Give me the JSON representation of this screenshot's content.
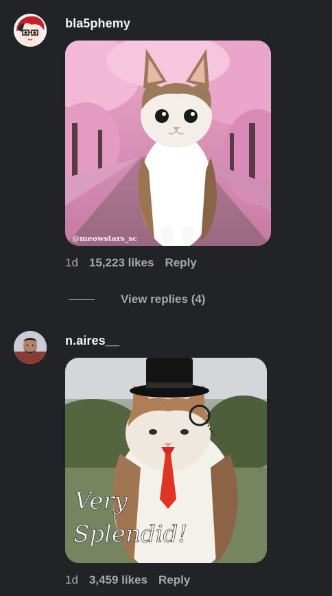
{
  "comments": [
    {
      "username": "bla5phemy",
      "media_watermark": "@meowstars_sc",
      "age": "1d",
      "likes": "15,223 likes",
      "reply_label": "Reply",
      "view_replies_label": "View replies (4)"
    },
    {
      "username": "n.aires__",
      "media_caption_line1": "Very",
      "media_caption_line2": "Splendid!",
      "age": "1d",
      "likes": "3,459 likes",
      "reply_label": "Reply"
    }
  ],
  "colors": {
    "background": "#222327",
    "primary_text": "#f5f5f5",
    "secondary_text": "#a8a8a8"
  }
}
